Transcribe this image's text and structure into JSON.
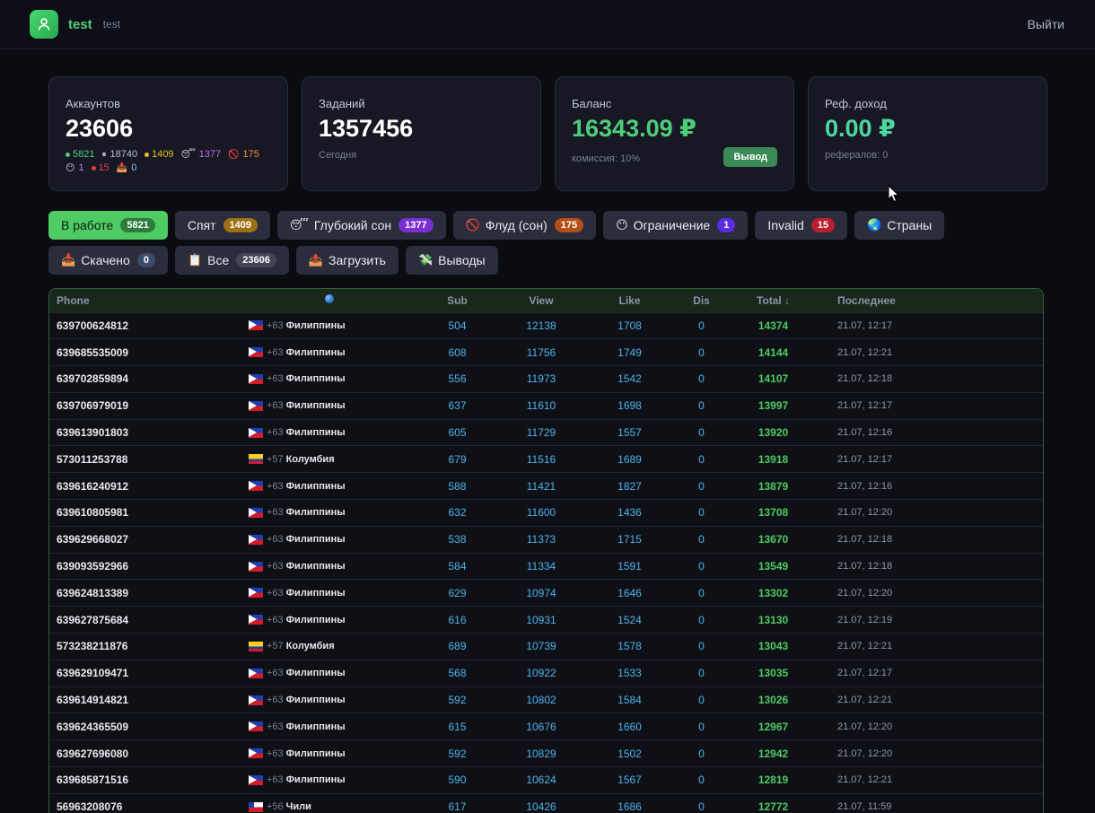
{
  "header": {
    "title": "test",
    "subtitle": "test",
    "logout_label": "Выйти"
  },
  "cards": {
    "accounts": {
      "title": "Аккаунтов",
      "value": "23606",
      "legend": [
        {
          "icon": "green-dot",
          "color": "#4fce7a",
          "text": "5821"
        },
        {
          "icon": "pause-icon",
          "color": "#b9bccb",
          "text": "18740"
        },
        {
          "icon": "yellow-dot",
          "color": "#e3c41b",
          "text": "1409"
        },
        {
          "icon": "sleepy-face-icon",
          "color": "#c06cf0",
          "text": "1377"
        },
        {
          "icon": "prohibited-icon",
          "color": "#f0913c",
          "text": "175"
        },
        {
          "icon": "restricted-face-icon",
          "color": "#9c8cf5",
          "text": "1"
        },
        {
          "icon": "red-dot",
          "color": "#e0424a",
          "text": "15"
        },
        {
          "icon": "download-box-icon",
          "color": "#8fb7f5",
          "text": "0"
        }
      ]
    },
    "tasks": {
      "title": "Заданий",
      "value": "1357456",
      "sub": "Сегодня"
    },
    "balance": {
      "title": "Баланс",
      "value": "16343.09 ₽",
      "sub": "комиссия: 10%",
      "button": "Вывод"
    },
    "ref": {
      "title": "Реф. доход",
      "value": "0.00 ₽",
      "sub": "рефералов: 0"
    }
  },
  "filters": [
    {
      "name": "in-work",
      "icon": "",
      "label": "В работе",
      "badge": "5821",
      "badge_class": "b-green",
      "active": true
    },
    {
      "name": "sleeping",
      "icon": "",
      "label": "Спят",
      "badge": "1409",
      "badge_class": "b-amber",
      "active": false
    },
    {
      "name": "deep-sleep",
      "icon": "😴",
      "label": "Глубокий сон",
      "badge": "1377",
      "badge_class": "b-purple",
      "active": false
    },
    {
      "name": "flood",
      "icon": "🚫",
      "label": "Флуд (сон)",
      "badge": "175",
      "badge_class": "b-orange",
      "active": false
    },
    {
      "name": "restriction",
      "icon": "😶",
      "label": "Ограничение",
      "badge": "1",
      "badge_class": "b-violet",
      "active": false
    },
    {
      "name": "invalid",
      "icon": "",
      "label": "Invalid",
      "badge": "15",
      "badge_class": "b-red",
      "active": false
    },
    {
      "name": "countries",
      "icon": "🌏",
      "label": "Страны",
      "badge": "",
      "badge_class": "",
      "active": false
    },
    {
      "name": "downloaded",
      "icon": "📥",
      "label": "Скачено",
      "badge": "0",
      "badge_class": "b-slate",
      "active": false
    },
    {
      "name": "all",
      "icon": "📋",
      "label": "Все",
      "badge": "23606",
      "badge_class": "b-gray",
      "active": false
    },
    {
      "name": "upload",
      "icon": "📤",
      "label": "Загрузить",
      "badge": "",
      "badge_class": "",
      "active": false
    },
    {
      "name": "withdrawals",
      "icon": "💸",
      "label": "Выводы",
      "badge": "",
      "badge_class": "",
      "active": false
    }
  ],
  "table": {
    "columns": {
      "phone": "Phone",
      "sub": "Sub",
      "view": "View",
      "like": "Like",
      "dis": "Dis",
      "total": "Total ↓",
      "last": "Последнее"
    },
    "rows": [
      {
        "phone": "639700624812",
        "flag": "ph",
        "code": "+63",
        "country": "Филиппины",
        "sub": "504",
        "view": "12138",
        "like": "1708",
        "dis": "0",
        "total": "14374",
        "last": "21.07, 12:17"
      },
      {
        "phone": "639685535009",
        "flag": "ph",
        "code": "+63",
        "country": "Филиппины",
        "sub": "608",
        "view": "11756",
        "like": "1749",
        "dis": "0",
        "total": "14144",
        "last": "21.07, 12:21"
      },
      {
        "phone": "639702859894",
        "flag": "ph",
        "code": "+63",
        "country": "Филиппины",
        "sub": "556",
        "view": "11973",
        "like": "1542",
        "dis": "0",
        "total": "14107",
        "last": "21.07, 12:18"
      },
      {
        "phone": "639706979019",
        "flag": "ph",
        "code": "+63",
        "country": "Филиппины",
        "sub": "637",
        "view": "11610",
        "like": "1698",
        "dis": "0",
        "total": "13997",
        "last": "21.07, 12:17"
      },
      {
        "phone": "639613901803",
        "flag": "ph",
        "code": "+63",
        "country": "Филиппины",
        "sub": "605",
        "view": "11729",
        "like": "1557",
        "dis": "0",
        "total": "13920",
        "last": "21.07, 12:16"
      },
      {
        "phone": "573011253788",
        "flag": "co",
        "code": "+57",
        "country": "Колумбия",
        "sub": "679",
        "view": "11516",
        "like": "1689",
        "dis": "0",
        "total": "13918",
        "last": "21.07, 12:17"
      },
      {
        "phone": "639616240912",
        "flag": "ph",
        "code": "+63",
        "country": "Филиппины",
        "sub": "588",
        "view": "11421",
        "like": "1827",
        "dis": "0",
        "total": "13879",
        "last": "21.07, 12:16"
      },
      {
        "phone": "639610805981",
        "flag": "ph",
        "code": "+63",
        "country": "Филиппины",
        "sub": "632",
        "view": "11600",
        "like": "1436",
        "dis": "0",
        "total": "13708",
        "last": "21.07, 12:20"
      },
      {
        "phone": "639629668027",
        "flag": "ph",
        "code": "+63",
        "country": "Филиппины",
        "sub": "538",
        "view": "11373",
        "like": "1715",
        "dis": "0",
        "total": "13670",
        "last": "21.07, 12:18"
      },
      {
        "phone": "639093592966",
        "flag": "ph",
        "code": "+63",
        "country": "Филиппины",
        "sub": "584",
        "view": "11334",
        "like": "1591",
        "dis": "0",
        "total": "13549",
        "last": "21.07, 12:18"
      },
      {
        "phone": "639624813389",
        "flag": "ph",
        "code": "+63",
        "country": "Филиппины",
        "sub": "629",
        "view": "10974",
        "like": "1646",
        "dis": "0",
        "total": "13302",
        "last": "21.07, 12:20"
      },
      {
        "phone": "639627875684",
        "flag": "ph",
        "code": "+63",
        "country": "Филиппины",
        "sub": "616",
        "view": "10931",
        "like": "1524",
        "dis": "0",
        "total": "13130",
        "last": "21.07, 12:19"
      },
      {
        "phone": "573238211876",
        "flag": "co",
        "code": "+57",
        "country": "Колумбия",
        "sub": "689",
        "view": "10739",
        "like": "1578",
        "dis": "0",
        "total": "13043",
        "last": "21.07, 12:21"
      },
      {
        "phone": "639629109471",
        "flag": "ph",
        "code": "+63",
        "country": "Филиппины",
        "sub": "568",
        "view": "10922",
        "like": "1533",
        "dis": "0",
        "total": "13035",
        "last": "21.07, 12:17"
      },
      {
        "phone": "639614914821",
        "flag": "ph",
        "code": "+63",
        "country": "Филиппины",
        "sub": "592",
        "view": "10802",
        "like": "1584",
        "dis": "0",
        "total": "13026",
        "last": "21.07, 12:21"
      },
      {
        "phone": "639624365509",
        "flag": "ph",
        "code": "+63",
        "country": "Филиппины",
        "sub": "615",
        "view": "10676",
        "like": "1660",
        "dis": "0",
        "total": "12967",
        "last": "21.07, 12:20"
      },
      {
        "phone": "639627696080",
        "flag": "ph",
        "code": "+63",
        "country": "Филиппины",
        "sub": "592",
        "view": "10829",
        "like": "1502",
        "dis": "0",
        "total": "12942",
        "last": "21.07, 12:20"
      },
      {
        "phone": "639685871516",
        "flag": "ph",
        "code": "+63",
        "country": "Филиппины",
        "sub": "590",
        "view": "10624",
        "like": "1567",
        "dis": "0",
        "total": "12819",
        "last": "21.07, 12:21"
      },
      {
        "phone": "56963208076",
        "flag": "cl",
        "code": "+56",
        "country": "Чили",
        "sub": "617",
        "view": "10426",
        "like": "1686",
        "dis": "0",
        "total": "12772",
        "last": "21.07, 11:59"
      }
    ]
  }
}
